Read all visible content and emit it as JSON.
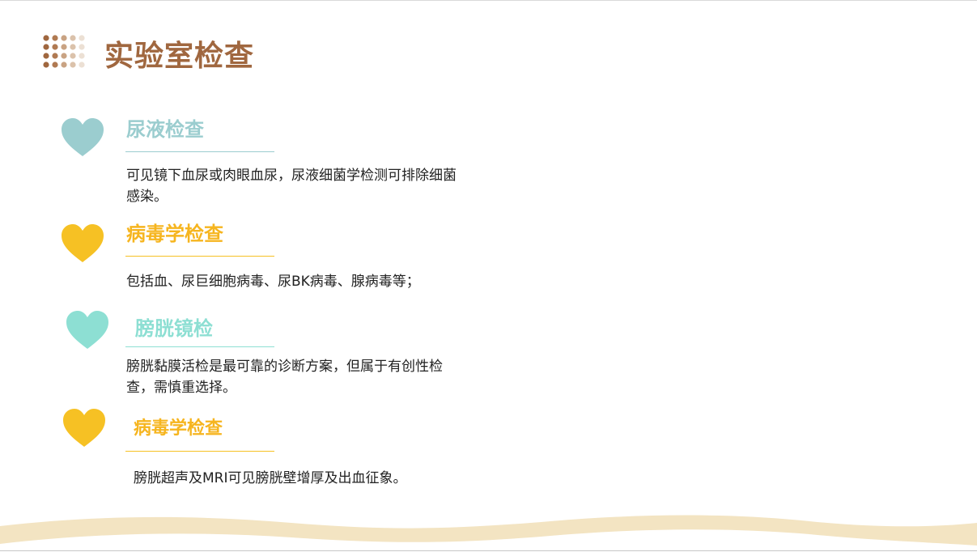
{
  "title": "实验室检查",
  "colors": {
    "title": "#a0673f",
    "teal": "#9bcdcf",
    "yellow": "#f6c124",
    "mint": "#8ddfd3",
    "wave": "#f3e4c2"
  },
  "sections": [
    {
      "heading": "尿液检查",
      "text": "可见镜下血尿或肉眼血尿，尿液细菌学检测可排除细菌感染。"
    },
    {
      "heading": "病毒学检查",
      "text": "包括血、尿巨细胞病毒、尿BK病毒、腺病毒等；"
    },
    {
      "heading": "膀胱镜检",
      "text": "膀胱黏膜活检是最可靠的诊断方案，但属于有创性检查，需慎重选择。"
    },
    {
      "heading": "病毒学检查",
      "text": "膀胱超声及MRI可见膀胱壁增厚及出血征象。"
    }
  ],
  "icons": {
    "title_decoration": "dot-grid-icon",
    "bullet": "heart-icon"
  }
}
